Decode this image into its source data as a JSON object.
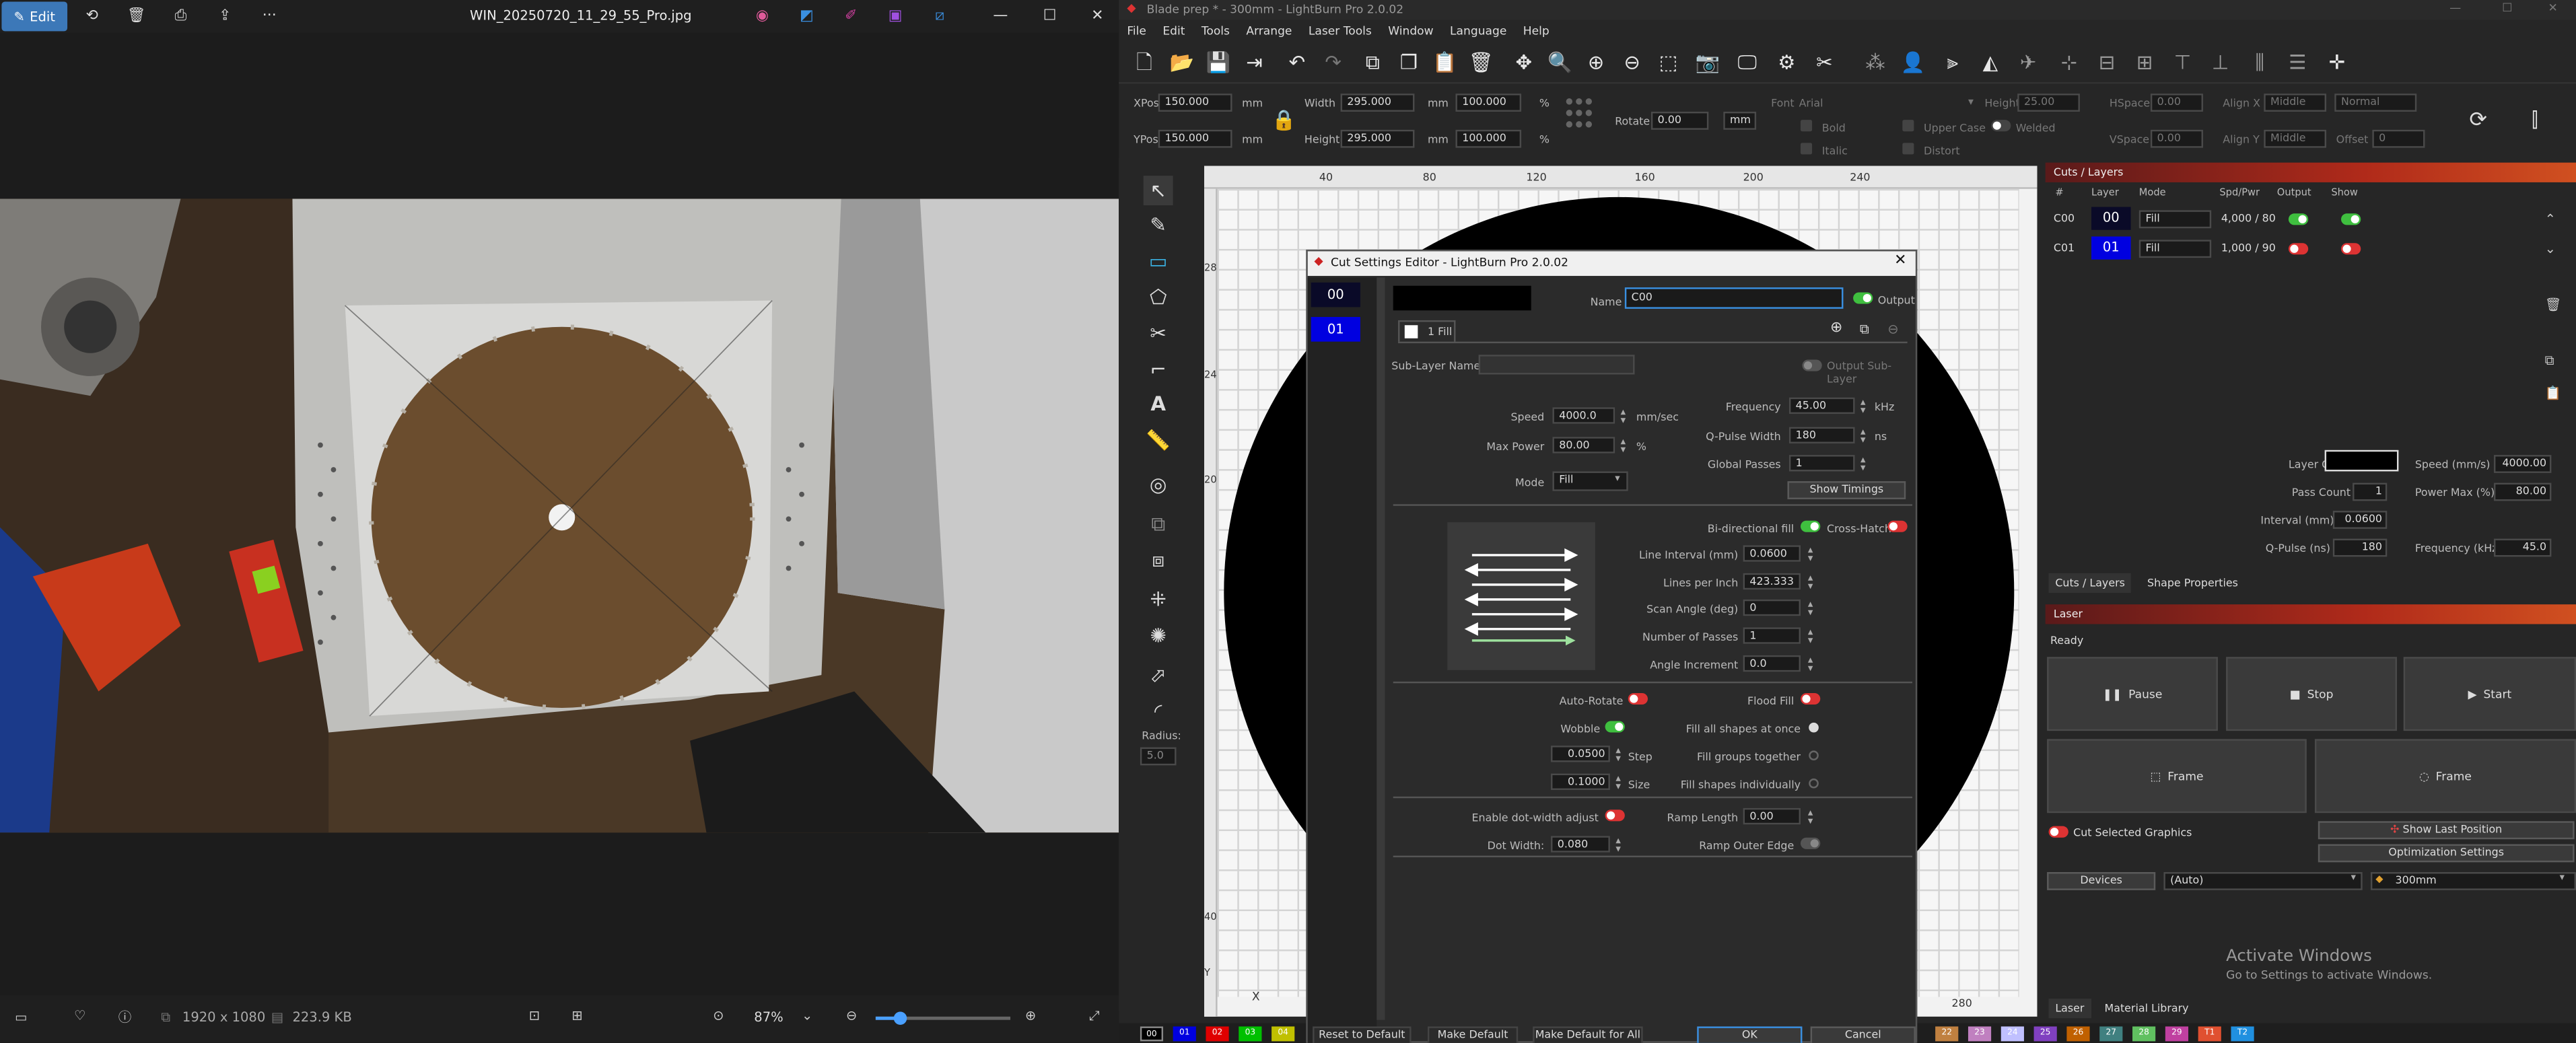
{
  "photo_viewer": {
    "edit_label": "Edit",
    "file_name": "WIN_20250720_11_29_55_Pro.jpg",
    "more_label": "···",
    "dimensions": "1920 x 1080",
    "file_size": "223.9 KB",
    "zoom": "87%"
  },
  "lightburn": {
    "window_title": "Blade prep * - 300mm - LightBurn Pro 2.0.02",
    "menu": [
      "File",
      "Edit",
      "Tools",
      "Arrange",
      "Laser Tools",
      "Window",
      "Language",
      "Help"
    ],
    "props": {
      "xpos_label": "XPos",
      "xpos": "150.000",
      "ypos_label": "YPos",
      "ypos": "150.000",
      "unit_mm": "mm",
      "unit_pct": "%",
      "width_label": "Width",
      "width": "295.000",
      "width_pct": "100.000",
      "height_label": "Height",
      "height": "295.000",
      "height_pct": "100.000",
      "rotate_label": "Rotate",
      "rotate": "0.00",
      "rotate_unit": "mm",
      "font_label": "Font",
      "font": "Arial",
      "font_height_label": "Height",
      "font_height": "25.00",
      "hspace_label": "HSpace",
      "hspace": "0.00",
      "vspace_label": "VSpace",
      "vspace": "0.00",
      "alignx_label": "Align X",
      "alignx": "Middle",
      "aligny_label": "Align Y",
      "aligny": "Middle",
      "normal": "Normal",
      "offset_label": "Offset",
      "offset": "0",
      "bold": "Bold",
      "italic": "Italic",
      "upper_case": "Upper Case",
      "distort": "Distort",
      "welded": "Welded"
    },
    "radius_label": "Radius:",
    "radius": "5.0",
    "ruler_top": [
      "40",
      "80",
      "120",
      "160",
      "200",
      "240"
    ],
    "ruler_bottom": [
      "X",
      "280"
    ],
    "ruler_left": [
      "280",
      "240",
      "200",
      "40"
    ],
    "ruler_y": "Y",
    "cuts": {
      "title": "Cuts / Layers",
      "headers": [
        "#",
        "Layer",
        "Mode",
        "Spd/Pwr",
        "Output",
        "Show"
      ],
      "rows": [
        {
          "id": "C00",
          "layer": "00",
          "mode": "Fill",
          "spdpwr": "4,000 / 80",
          "color": "#0a0a28"
        },
        {
          "id": "C01",
          "layer": "01",
          "mode": "Fill",
          "spdpwr": "1,000 / 90",
          "color": "#0000e0"
        }
      ],
      "layer_color_label": "Layer Color",
      "speed_label": "Speed (mm/s)",
      "speed": "4000.00",
      "pass_count_label": "Pass Count",
      "pass_count": "1",
      "power_max_label": "Power Max (%)",
      "power_max": "80.00",
      "interval_label": "Interval (mm)",
      "interval": "0.0600",
      "qpulse_label": "Q-Pulse (ns)",
      "qpulse": "180",
      "frequency_label": "Frequency (kHz)",
      "frequency": "45.0",
      "tabs": [
        "Cuts / Layers",
        "Shape Properties"
      ]
    },
    "laser": {
      "title": "Laser",
      "status": "Ready",
      "pause": "Pause",
      "stop": "Stop",
      "start": "Start",
      "frame1": "Frame",
      "frame2": "Frame",
      "cut_selected": "Cut Selected Graphics",
      "show_last": "Show Last Position",
      "optimization": "Optimization Settings",
      "devices": "Devices",
      "auto": "(Auto)",
      "device_name": "300mm",
      "tabs": [
        "Laser",
        "Material Library"
      ]
    },
    "watermark_title": "Activate Windows",
    "watermark_sub": "Go to Settings to activate Windows.",
    "palette": [
      "00",
      "01",
      "02",
      "03",
      "04"
    ],
    "palette_right": [
      "22",
      "23",
      "24",
      "25",
      "26",
      "27",
      "28",
      "29",
      "T1",
      "T2"
    ]
  },
  "dialog": {
    "title": "Cut Settings Editor - LightBurn Pro 2.0.02",
    "layers": [
      "00",
      "01"
    ],
    "name_label": "Name",
    "name": "C00",
    "output_label": "Output",
    "sublayer_tab": "1 Fill",
    "sublayer_name_label": "Sub-Layer Name",
    "output_sublayer_label": "Output Sub-Layer",
    "speed_label": "Speed",
    "speed": "4000.0",
    "speed_unit": "mm/sec",
    "max_power_label": "Max Power",
    "max_power": "80.00",
    "max_power_unit": "%",
    "mode_label": "Mode",
    "mode": "Fill",
    "frequency_label": "Frequency",
    "frequency": "45.00",
    "frequency_unit": "kHz",
    "qpulse_label": "Q-Pulse Width",
    "qpulse": "180",
    "qpulse_unit": "ns",
    "global_passes_label": "Global Passes",
    "global_passes": "1",
    "show_timings": "Show Timings",
    "bidir_label": "Bi-directional fill",
    "crosshatch_label": "Cross-Hatch",
    "line_interval_label": "Line Interval (mm)",
    "line_interval": "0.0600",
    "lpi_label": "Lines per Inch",
    "lpi": "423.333",
    "scan_angle_label": "Scan Angle (deg)",
    "scan_angle": "0",
    "num_passes_label": "Number of Passes",
    "num_passes": "1",
    "angle_inc_label": "Angle Increment",
    "angle_inc": "0.0",
    "auto_rotate_label": "Auto-Rotate",
    "flood_fill_label": "Flood Fill",
    "wobble_label": "Wobble",
    "fill_all_label": "Fill all shapes at once",
    "step_label": "Step",
    "step": "0.0500",
    "fill_groups_label": "Fill groups together",
    "size_label": "Size",
    "size": "0.1000",
    "fill_indiv_label": "Fill shapes individually",
    "dot_width_adjust_label": "Enable dot-width adjust",
    "ramp_length_label": "Ramp Length",
    "ramp_length": "0.00",
    "dot_width_label": "Dot Width:",
    "dot_width": "0.080",
    "ramp_outer_label": "Ramp Outer Edge",
    "reset": "Reset to Default",
    "make_default": "Make Default",
    "make_default_all": "Make Default for All",
    "ok": "OK",
    "cancel": "Cancel"
  }
}
